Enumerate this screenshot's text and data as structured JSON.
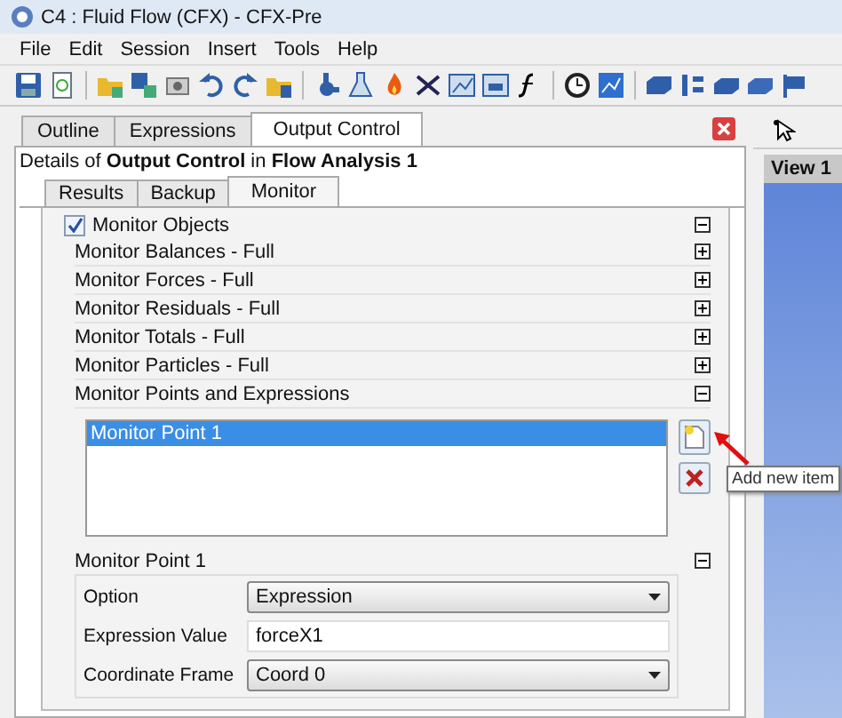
{
  "window": {
    "title": "C4 : Fluid Flow (CFX) - CFX-Pre"
  },
  "menu": [
    "File",
    "Edit",
    "Session",
    "Insert",
    "Tools",
    "Help"
  ],
  "panel_tabs": [
    {
      "label": "Outline",
      "selected": false
    },
    {
      "label": "Expressions",
      "selected": false
    },
    {
      "label": "Output Control",
      "selected": true
    }
  ],
  "details": "Details of **Output Control** in **Flow Analysis 1**",
  "sub_tabs": [
    {
      "label": "Results",
      "selected": false
    },
    {
      "label": "Backup",
      "selected": false
    },
    {
      "label": "Monitor",
      "selected": true
    }
  ],
  "monitor_objects": {
    "label": "Monitor Objects",
    "checked": true,
    "expanded": true
  },
  "sections": [
    {
      "label": "Monitor Balances - Full",
      "expanded": false
    },
    {
      "label": "Monitor Forces - Full",
      "expanded": false
    },
    {
      "label": "Monitor Residuals - Full",
      "expanded": false
    },
    {
      "label": "Monitor Totals - Full",
      "expanded": false
    },
    {
      "label": "Monitor Particles - Full",
      "expanded": false
    },
    {
      "label": "Monitor Points and Expressions",
      "expanded": true
    }
  ],
  "points_list": [
    {
      "label": "Monitor Point 1",
      "selected": true
    }
  ],
  "tooltip": "Add new item",
  "point_details": {
    "title": "Monitor Point 1",
    "expanded": true,
    "fields": [
      {
        "kind": "dropdown",
        "label": "Option",
        "value": "Expression"
      },
      {
        "kind": "text",
        "label": "Expression Value",
        "value": "forceX1"
      },
      {
        "kind": "dropdown",
        "label": "Coordinate Frame",
        "value": "Coord 0"
      }
    ]
  },
  "viewport": {
    "title": "View 1"
  }
}
